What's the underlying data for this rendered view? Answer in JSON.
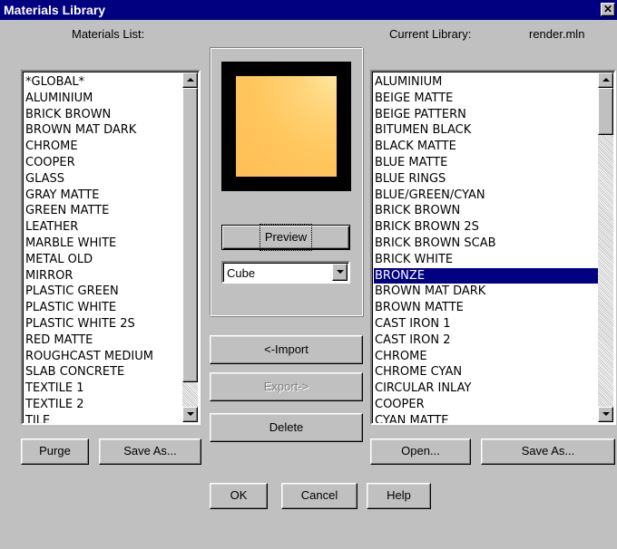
{
  "window": {
    "title": "Materials Library",
    "close_glyph": "✕"
  },
  "left": {
    "header": "Materials List:",
    "items": [
      "*GLOBAL*",
      "ALUMINIUM",
      "BRICK BROWN",
      "BROWN MAT DARK",
      "CHROME",
      "COOPER",
      "GLASS",
      "GRAY MATTE",
      "GREEN MATTE",
      "LEATHER",
      "MARBLE WHITE",
      "METAL OLD",
      "MIRROR",
      "PLASTIC GREEN",
      "PLASTIC WHITE",
      "PLASTIC WHITE 2S",
      "RED MATTE",
      "ROUGHCAST MEDIUM",
      "SLAB CONCRETE",
      "TEXTILE 1",
      "TEXTILE 2",
      "TILE"
    ],
    "purge_label": "Purge",
    "save_as_label": "Save As..."
  },
  "center": {
    "preview_label": "Preview",
    "shape_value": "Cube",
    "import_label": "<-Import",
    "export_label": "Export->",
    "delete_label": "Delete"
  },
  "right": {
    "header": "Current Library:",
    "filename": "render.mln",
    "items": [
      "ALUMINIUM",
      "BEIGE MATTE",
      "BEIGE PATTERN",
      "BITUMEN BLACK",
      "BLACK MATTE",
      "BLUE MATTE",
      "BLUE RINGS",
      "BLUE/GREEN/CYAN",
      "BRICK BROWN",
      "BRICK BROWN 2S",
      "BRICK BROWN SCAB",
      "BRICK WHITE",
      "BRONZE",
      "BROWN MAT DARK",
      "BROWN MATTE",
      "CAST IRON 1",
      "CAST IRON 2",
      "CHROME",
      "CHROME CYAN",
      "CIRCULAR INLAY",
      "COOPER",
      "CYAN MATTE"
    ],
    "selected": "BRONZE",
    "open_label": "Open...",
    "save_as_label": "Save As..."
  },
  "footer": {
    "ok_label": "OK",
    "cancel_label": "Cancel",
    "help_label": "Help"
  },
  "colors": {
    "titlebar": "#000080",
    "selection": "#000080",
    "swatch": "#ffc35a"
  }
}
